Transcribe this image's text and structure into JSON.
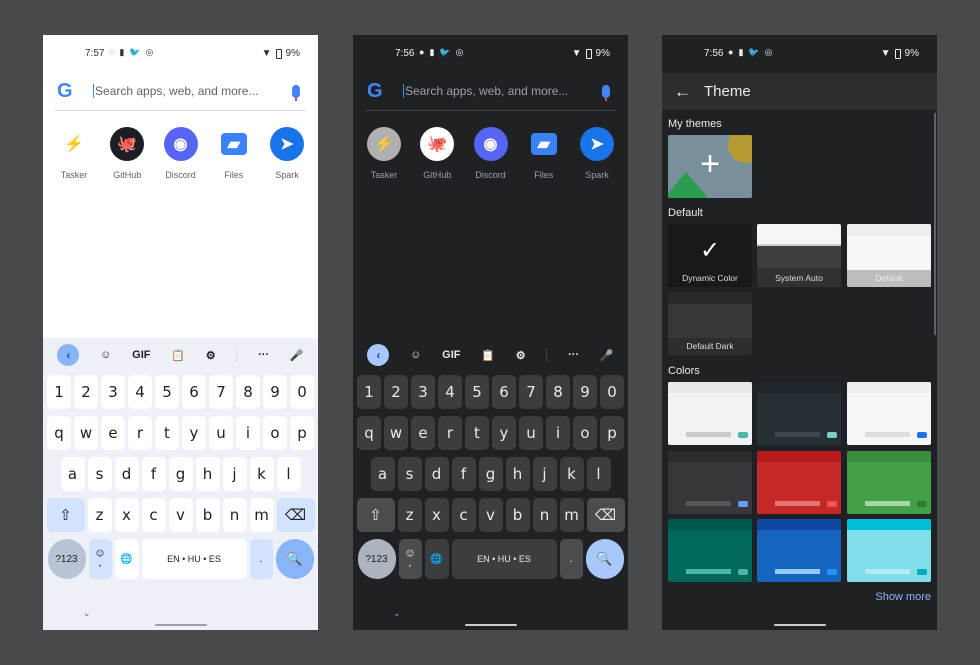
{
  "phones": [
    {
      "theme": "light",
      "time": "7:57",
      "battery": "9%",
      "status_icons": [
        "◌",
        "▮",
        "🐦",
        "◎"
      ]
    },
    {
      "theme": "dark",
      "time": "7:56",
      "battery": "9%",
      "status_icons": [
        "●",
        "▮",
        "🐦",
        "◎"
      ]
    },
    {
      "theme": "dark",
      "time": "7:56",
      "battery": "9%",
      "status_icons": [
        "●",
        "▮",
        "🐦",
        "◎"
      ]
    }
  ],
  "search": {
    "placeholder": "Search apps, web, and more...",
    "logo": "G"
  },
  "apps": [
    {
      "label": "Tasker",
      "icon": "tasker-icon",
      "color": "#b0b0b0",
      "glyph": "⚡"
    },
    {
      "label": "GitHub",
      "icon": "github-icon",
      "color": "#1b1f23",
      "glyph": "🐙"
    },
    {
      "label": "Discord",
      "icon": "discord-icon",
      "color": "#5865f2",
      "glyph": "◉"
    },
    {
      "label": "Files",
      "icon": "files-icon",
      "color": "#3b82f6",
      "glyph": "▰"
    },
    {
      "label": "Spark",
      "icon": "spark-icon",
      "color": "#1a73e8",
      "glyph": "➤"
    }
  ],
  "keyboard": {
    "toolbar": [
      {
        "name": "back",
        "glyph": "‹"
      },
      {
        "name": "sticker",
        "glyph": "☺"
      },
      {
        "name": "gif",
        "glyph": "GIF"
      },
      {
        "name": "clipboard",
        "glyph": "📋"
      },
      {
        "name": "settings",
        "glyph": "⚙"
      },
      {
        "name": "more",
        "glyph": "···"
      },
      {
        "name": "voice",
        "glyph": "🎤"
      }
    ],
    "rows": [
      [
        "1",
        "2",
        "3",
        "4",
        "5",
        "6",
        "7",
        "8",
        "9",
        "0"
      ],
      [
        "q",
        "w",
        "e",
        "r",
        "t",
        "y",
        "u",
        "i",
        "o",
        "p"
      ],
      [
        "a",
        "s",
        "d",
        "f",
        "g",
        "h",
        "j",
        "k",
        "l"
      ],
      [
        "z",
        "x",
        "c",
        "v",
        "b",
        "n",
        "m"
      ]
    ],
    "shift": "⇧",
    "backspace": "⌫",
    "symbols": "?123",
    "emoji": "☺",
    "comma": ",",
    "globe": "🌐",
    "space": "EN • HU • ES",
    "period": ".",
    "search": "🔍",
    "hide": "⌄"
  },
  "theme_screen": {
    "title": "Theme",
    "back": "←",
    "my_themes": "My themes",
    "add": "+",
    "default_label": "Default",
    "defaults": [
      {
        "label": "Dynamic Color"
      },
      {
        "label": "System Auto"
      },
      {
        "label": "Default"
      },
      {
        "label": "Default Dark"
      }
    ],
    "colors_label": "Colors",
    "colors": [
      {
        "top": "#e8e9eb",
        "body": "#f1f2f4",
        "bar": "#c9cacd",
        "accent": "#4db6ac"
      },
      {
        "top": "#1f2528",
        "body": "#263035",
        "bar": "#3d474c",
        "accent": "#80cbc4"
      },
      {
        "top": "#eeeff1",
        "body": "#f6f7f9",
        "bar": "#dcdde0",
        "accent": "#1a73e8"
      },
      {
        "top": "#2a2c2f",
        "body": "#35373a",
        "bar": "#55575a",
        "accent": "#669df6"
      },
      {
        "top": "#b71c1c",
        "body": "#c62828",
        "bar": "#e57373",
        "accent": "#ef5350"
      },
      {
        "top": "#388e3c",
        "body": "#43a047",
        "bar": "#a5d6a7",
        "accent": "#2e7d32"
      },
      {
        "top": "#00574b",
        "body": "#00695c",
        "bar": "#4db6ac",
        "accent": "#4db6ac"
      },
      {
        "top": "#0d47a1",
        "body": "#1565c0",
        "bar": "#90caf9",
        "accent": "#2196f3"
      },
      {
        "top": "#00bcd4",
        "body": "#80deea",
        "bar": "#b2ebf2",
        "accent": "#00acc1"
      }
    ],
    "show_more": "Show more",
    "selected": "Dynamic Color"
  }
}
